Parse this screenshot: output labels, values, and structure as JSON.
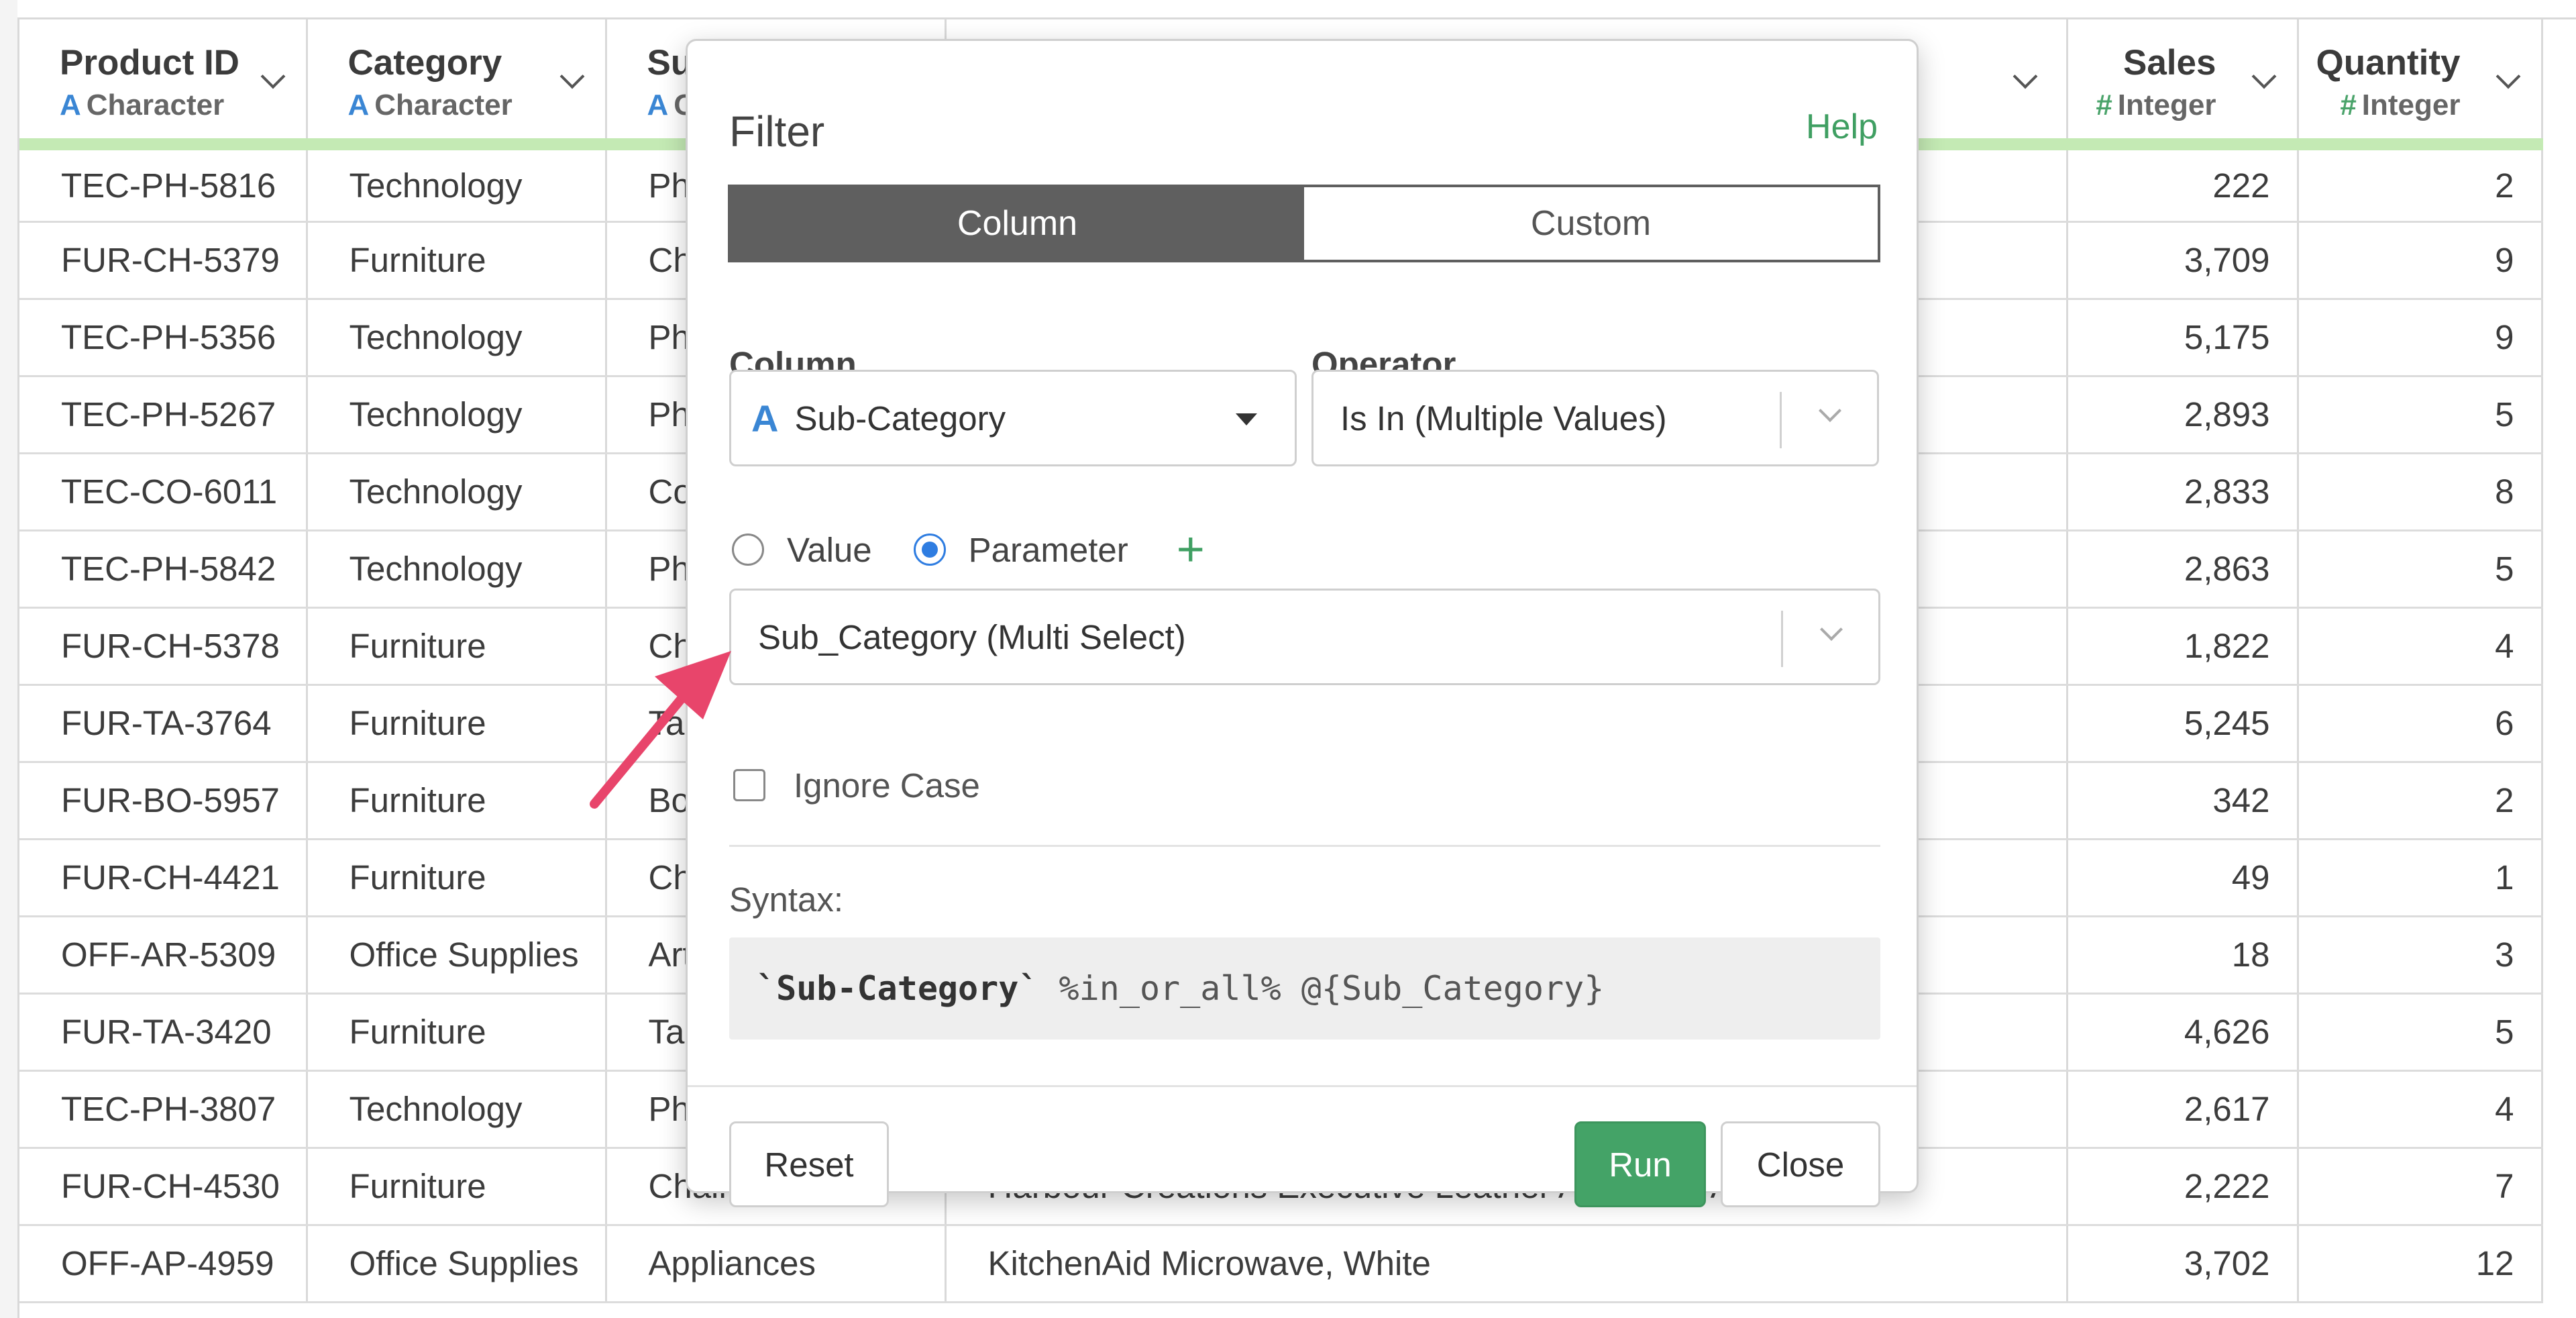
{
  "table": {
    "columns": [
      {
        "name": "Product ID",
        "type": "Character",
        "glyph": "A"
      },
      {
        "name": "Category",
        "type": "Character",
        "glyph": "A"
      },
      {
        "name": "Su",
        "type": "C",
        "glyph": "A"
      },
      {
        "name": "",
        "type": "",
        "glyph": ""
      },
      {
        "name": "Sales",
        "type": "Integer",
        "glyph": "#"
      },
      {
        "name": "Quantity",
        "type": "Integer",
        "glyph": "#"
      }
    ],
    "rows": [
      [
        "TEC-PH-5816",
        "Technology",
        "Ph",
        "",
        "222",
        "2"
      ],
      [
        "FUR-CH-5379",
        "Furniture",
        "Ch",
        "",
        "3,709",
        "9"
      ],
      [
        "TEC-PH-5356",
        "Technology",
        "Ph",
        "",
        "5,175",
        "9"
      ],
      [
        "TEC-PH-5267",
        "Technology",
        "Ph",
        "",
        "2,893",
        "5"
      ],
      [
        "TEC-CO-6011",
        "Technology",
        "Co",
        "",
        "2,833",
        "8"
      ],
      [
        "TEC-PH-5842",
        "Technology",
        "Ph",
        "",
        "2,863",
        "5"
      ],
      [
        "FUR-CH-5378",
        "Furniture",
        "Ch",
        "",
        "1,822",
        "4"
      ],
      [
        "FUR-TA-3764",
        "Furniture",
        "Ta",
        "",
        "5,245",
        "6"
      ],
      [
        "FUR-BO-5957",
        "Furniture",
        "Bo",
        "",
        "342",
        "2"
      ],
      [
        "FUR-CH-4421",
        "Furniture",
        "Ch",
        "",
        "49",
        "1"
      ],
      [
        "OFF-AR-5309",
        "Office Supplies",
        "Art",
        "",
        "18",
        "3"
      ],
      [
        "FUR-TA-3420",
        "Furniture",
        "Tab",
        "",
        "4,626",
        "5"
      ],
      [
        "TEC-PH-3807",
        "Technology",
        "Ph",
        "",
        "2,617",
        "4"
      ],
      [
        "FUR-CH-4530",
        "Furniture",
        "Chairs",
        "Harbour Creations Executive Leather Armchair, Adjustable",
        "2,222",
        "7"
      ],
      [
        "OFF-AP-4959",
        "Office Supplies",
        "Appliances",
        "KitchenAid Microwave, White",
        "3,702",
        "12"
      ]
    ]
  },
  "modal": {
    "title": "Filter",
    "help": "Help",
    "tabs": {
      "column": "Column",
      "custom": "Custom"
    },
    "column_label": "Column",
    "operator_label": "Operator",
    "column_glyph": "A",
    "column_value": "Sub-Category",
    "operator_value": "Is In (Multiple Values)",
    "radio_value": "Value",
    "radio_parameter": "Parameter",
    "plus": "+",
    "parameter_value": "Sub_Category (Multi Select)",
    "ignore_case": "Ignore Case",
    "syntax_label": "Syntax:",
    "syntax_strong": "`Sub-Category`",
    "syntax_rest": " %in_or_all% @{Sub_Category}",
    "reset": "Reset",
    "run": "Run",
    "close": "Close"
  },
  "colors": {
    "accent_green": "#44a367",
    "header_underline": "#c4eab4",
    "annotation_arrow": "#e8456b",
    "radio_blue": "#2f7de1"
  }
}
